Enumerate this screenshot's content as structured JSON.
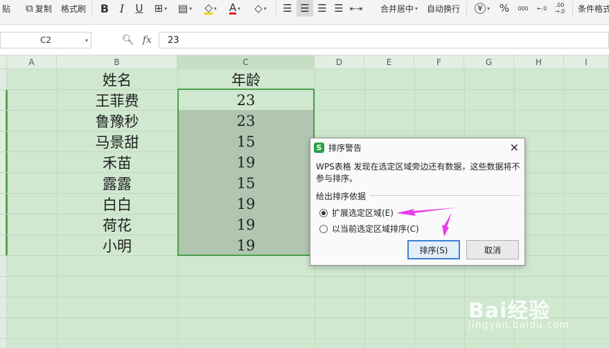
{
  "toolbar": {
    "paste_label": "贴",
    "copy_label": "复制",
    "format_painter_label": "格式刷",
    "bold_glyph": "B",
    "italic_glyph": "I",
    "underline_glyph": "U",
    "font_color_glyph": "A",
    "percent_glyph": "%",
    "merge_center_label": "合并居中",
    "wrap_text_label": "自动换行",
    "conditional_format_label": "条件格式",
    "inc_decimal_glyph": "000",
    "inc_decimal_glyph2": "←.0",
    "dec_decimal_glyph": ".00",
    "dec_decimal_glyph2": "→.0"
  },
  "formula_bar": {
    "name_box": "C2",
    "fx_label": "fx",
    "value": "23"
  },
  "columns": [
    "A",
    "B",
    "C",
    "D",
    "E",
    "F",
    "G",
    "H",
    "I"
  ],
  "sheet": {
    "header_name": "姓名",
    "header_age": "年龄",
    "rows": [
      {
        "name": "王菲费",
        "age": "23"
      },
      {
        "name": "鲁豫秒",
        "age": "23"
      },
      {
        "name": "马景甜",
        "age": "15"
      },
      {
        "name": "禾苗",
        "age": "19"
      },
      {
        "name": "露露",
        "age": "15"
      },
      {
        "name": "白白",
        "age": "19"
      },
      {
        "name": "荷花",
        "age": "19"
      },
      {
        "name": "小明",
        "age": "19"
      }
    ]
  },
  "dialog": {
    "title": "排序警告",
    "logo": "S",
    "close": "✕",
    "message": "WPS表格 发现在选定区域旁边还有数据，这些数据将不参与排序。",
    "group_label": "给出排序依据",
    "option_expand": "扩展选定区域(E)",
    "option_current": "以当前选定区域排序(C)",
    "sort_button": "排序(S)",
    "cancel_button": "取消"
  },
  "watermark": {
    "main": "Bai经验",
    "sub": "jingyan.baidu.com"
  },
  "colors": {
    "grid_bg": "#cfe8cf",
    "selection_border": "#4a9f4a",
    "annotation_arrow": "#e83de8",
    "primary_button_border": "#3d7fd6"
  }
}
